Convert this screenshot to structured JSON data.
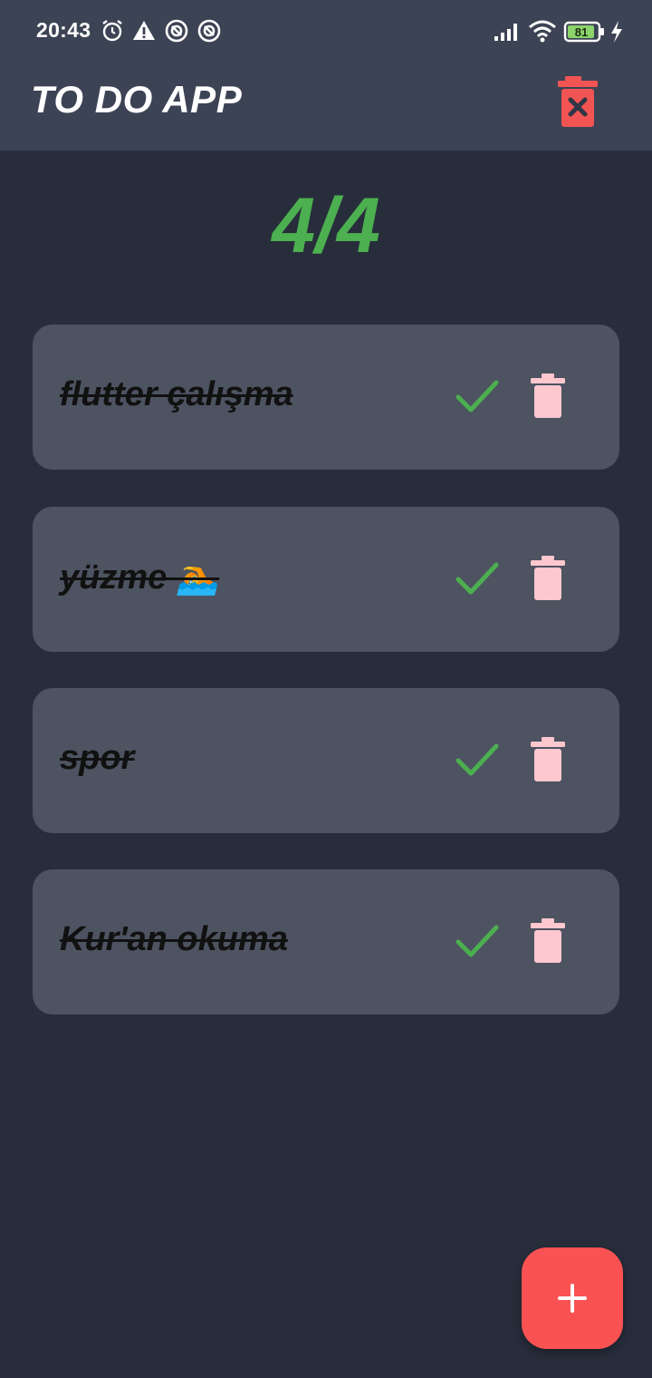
{
  "status_bar": {
    "time": "20:43",
    "battery": "81"
  },
  "app_bar": {
    "title": "TO DO APP",
    "clear_icon": "trash-x-icon"
  },
  "counter": {
    "text": "4/4",
    "completed": 4,
    "total": 4
  },
  "tasks": [
    {
      "title": "flutter çalışma",
      "done": true
    },
    {
      "title": "yüzme 🏊",
      "done": true
    },
    {
      "title": "spor",
      "done": true
    },
    {
      "title": "Kur'an okuma",
      "done": true
    }
  ],
  "colors": {
    "background": "#282d3c",
    "app_bar": "#3c4354",
    "card": "#4d5361",
    "accent_green": "#4caf50",
    "danger_red": "#fa5252",
    "delete_pink": "#ffc8cf"
  },
  "fab": {
    "icon": "plus-icon"
  }
}
